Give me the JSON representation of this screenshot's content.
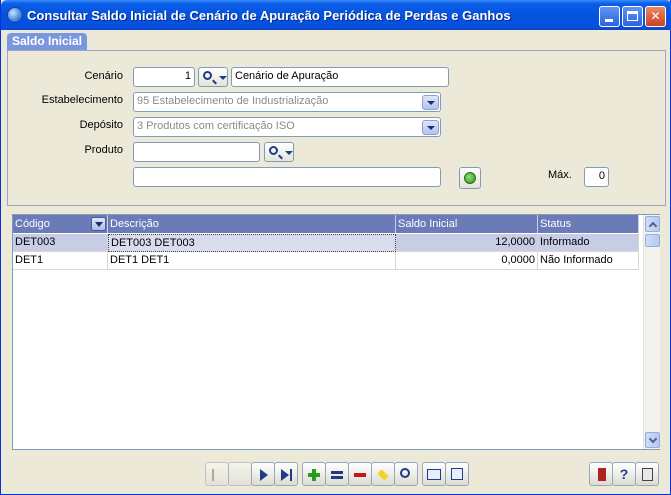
{
  "window": {
    "title": "Consultar Saldo Inicial de Cenário de Apuração Periódica de Perdas e Ganhos"
  },
  "tab": {
    "label": "Saldo Inicial"
  },
  "form": {
    "cenario": {
      "label": "Cenário",
      "code": "1",
      "description": "Cenário de Apuração"
    },
    "estabelecimento": {
      "label": "Estabelecimento",
      "value": "95 Estabelecimento de Industrialização"
    },
    "deposito": {
      "label": "Depósito",
      "value": "3 Produtos com certificação ISO"
    },
    "produto": {
      "label": "Produto",
      "code": "",
      "description": ""
    },
    "max": {
      "label": "Máx.",
      "value": "0"
    }
  },
  "table": {
    "columns": [
      "Código",
      "Descrição",
      "Saldo Inicial",
      "Status"
    ],
    "rows": [
      {
        "codigo": "DET003",
        "descricao": "DET003 DET003",
        "saldo": "12,0000",
        "status": "Informado"
      },
      {
        "codigo": "DET1",
        "descricao": "DET1 DET1",
        "saldo": "0,0000",
        "status": "Não Informado"
      }
    ]
  },
  "toolbar": {
    "buttons": [
      "first",
      "prev",
      "next",
      "last",
      "add",
      "edit",
      "delete",
      "highlight",
      "search",
      "form-view",
      "export"
    ],
    "help_label": "?"
  }
}
